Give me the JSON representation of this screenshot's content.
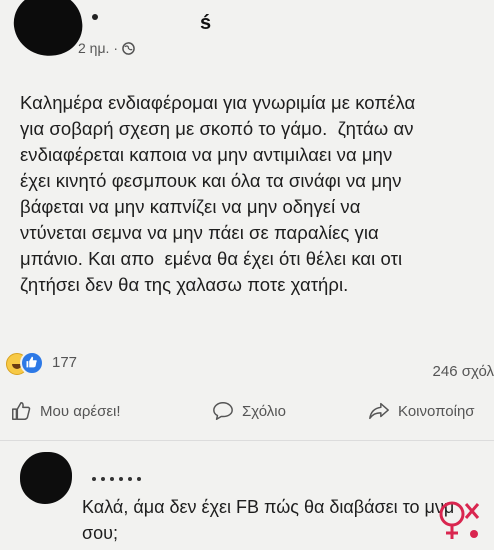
{
  "post": {
    "author_suffix": "ś",
    "time": "2 ημ.",
    "separator": "·",
    "body": "Καλημέρα ενδιαφέρομαι για γνωριμία με κοπέλα\nγια σοβαρή σχεση με σκοπό το γάμο.  ζητάω αν\nενδιαφέρεται καποια να μην αντιμιλαει να μην\nέχει κινητό φεσμπουκ και όλα τα σινάφι να μην\nβάφεται να μην καπνίζει να μην οδηγεί να\nντύνεται σεμνα να μην πάει σε παραλίες για\nμπάνιο. Και απο  εμένα θα έχει ότι θέλει και οτι\nζητήσει δεν θα της χαλασω ποτε χατήρι."
  },
  "stats": {
    "reaction_count": "177",
    "comments": "246 σχόλ"
  },
  "actions": {
    "like": "Μου αρέσει!",
    "comment": "Σχόλιο",
    "share": "Κοινοποίησ"
  },
  "comment": {
    "text": "Καλά, άμα δεν έχει FB πώς θα διαβάσει το μνμ σου;"
  },
  "icons": {
    "privacy": "globe-icon",
    "like": "thumbs-up-icon",
    "comment": "speech-bubble-icon",
    "share": "share-arrow-icon"
  },
  "colors": {
    "background": "#f2f2f0",
    "like_blue": "#2d79e6",
    "haha_yellow": "#f7c945",
    "watermark_red": "#d9264f"
  }
}
